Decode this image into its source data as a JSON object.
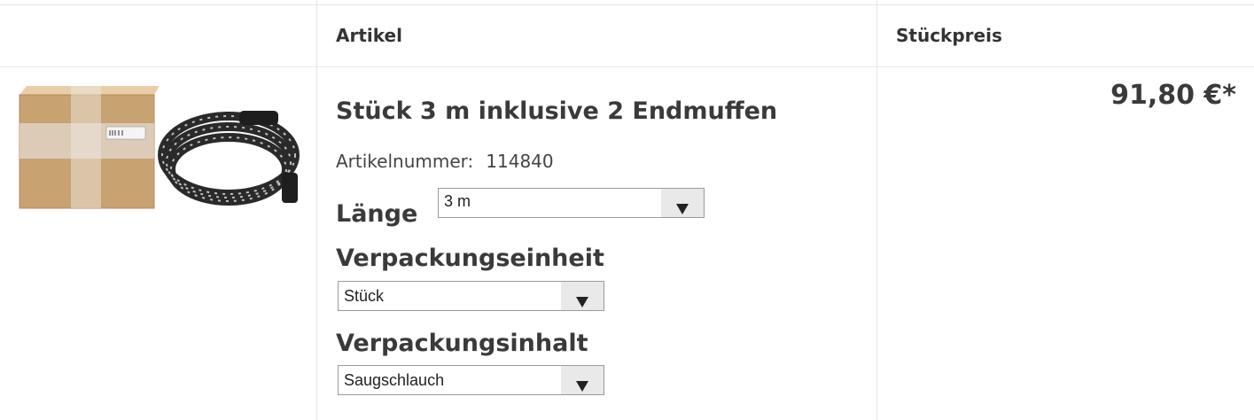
{
  "table_header": {
    "article": "Artikel",
    "unit_price": "Stückpreis"
  },
  "product": {
    "title": "Stück 3 m inklusive 2 Endmuffen",
    "sku_label": "Artikelnummer:",
    "sku_value": "114840",
    "price": "91,80 €*",
    "image_name": "vacuum-hose-with-box-image"
  },
  "options": {
    "length": {
      "label": "Länge",
      "value": "3 m"
    },
    "package_unit": {
      "label": "Verpackungseinheit",
      "value": "Stück"
    },
    "package_content": {
      "label": "Verpackungsinhalt",
      "value": "Saugschlauch"
    }
  },
  "colors": {
    "border": "#e6e6e6",
    "text": "#333333",
    "select_arrow_bg": "#e9e9e9"
  }
}
